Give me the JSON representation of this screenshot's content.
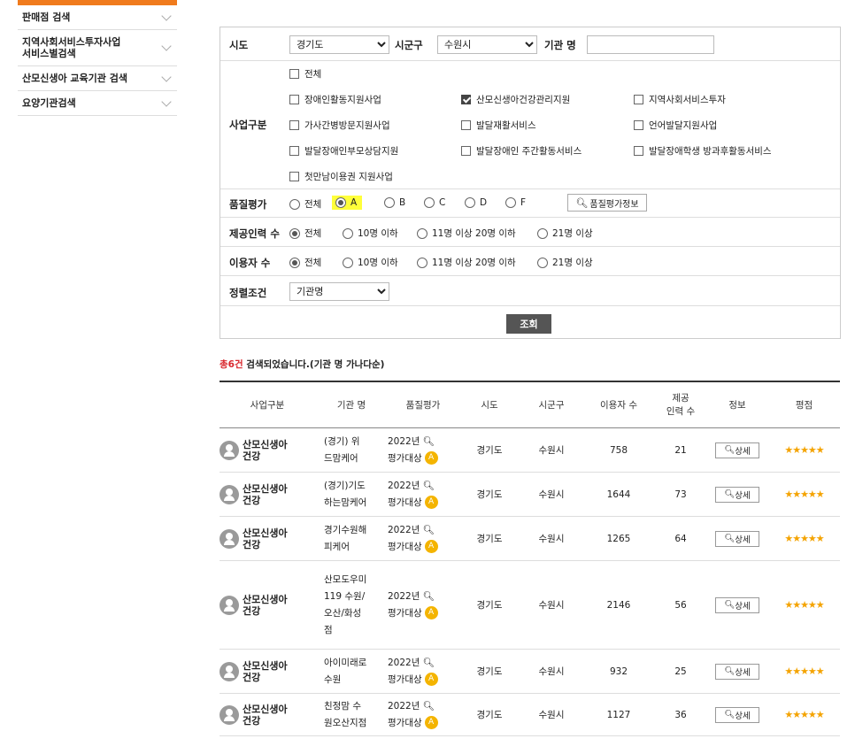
{
  "sidebar": {
    "items": [
      {
        "label": "판매점 검색"
      },
      {
        "label": "지역사회서비스투자사업\n서비스별검색"
      },
      {
        "label": "산모신생아 교육기관 검색"
      },
      {
        "label": "요양기관검색"
      }
    ]
  },
  "form": {
    "region_label": "시도",
    "region_value": "경기도",
    "district_label": "시군구",
    "district_value": "수원시",
    "org_name_label": "기관 명",
    "org_name_value": "",
    "biz_label": "사업구분",
    "biz_options": [
      {
        "label": "전체",
        "checked": false
      },
      {
        "label": "장애인활동지원사업",
        "checked": false
      },
      {
        "label": "산모신생아건강관리지원",
        "checked": true
      },
      {
        "label": "지역사회서비스투자",
        "checked": false
      },
      {
        "label": "가사간병방문지원사업",
        "checked": false
      },
      {
        "label": "발달재활서비스",
        "checked": false
      },
      {
        "label": "언어발달지원사업",
        "checked": false
      },
      {
        "label": "발달장애인부모상담지원",
        "checked": false
      },
      {
        "label": "발달장애인 주간활동서비스",
        "checked": false
      },
      {
        "label": "발달장애학생 방과후활동서비스",
        "checked": false
      },
      {
        "label": "첫만남이용권 지원사업",
        "checked": false
      }
    ],
    "quality_label": "품질평가",
    "quality_options": [
      {
        "label": "전체",
        "selected": false
      },
      {
        "label": "A",
        "selected": true
      },
      {
        "label": "B",
        "selected": false
      },
      {
        "label": "C",
        "selected": false
      },
      {
        "label": "D",
        "selected": false
      },
      {
        "label": "F",
        "selected": false
      }
    ],
    "quality_info_button": "품질평가정보",
    "staff_label": "제공인력 수",
    "staff_options": [
      {
        "label": "전체",
        "selected": true
      },
      {
        "label": "10명 이하",
        "selected": false
      },
      {
        "label": "11명 이상 20명 이하",
        "selected": false
      },
      {
        "label": "21명 이상",
        "selected": false
      }
    ],
    "users_label": "이용자 수",
    "users_options": [
      {
        "label": "전체",
        "selected": true
      },
      {
        "label": "10명 이하",
        "selected": false
      },
      {
        "label": "11명 이상 20명 이하",
        "selected": false
      },
      {
        "label": "21명 이상",
        "selected": false
      }
    ],
    "sort_label": "정렬조건",
    "sort_value": "기관명",
    "submit_label": "조회"
  },
  "summary": {
    "count": "총6건",
    "text": " 검색되었습니다.(기관 명 가나다순)"
  },
  "table": {
    "headers": [
      "사업구분",
      "기관 명",
      "품질평가",
      "시도",
      "시군구",
      "이용자 수",
      "제공\n인력 수",
      "정보",
      "평점"
    ],
    "rows": [
      {
        "biz": "산모신생아\n건강",
        "org": "(경기) 위\n드맘케어",
        "year": "2022년",
        "eval": "평가대상",
        "grade": "A",
        "region": "경기도",
        "district": "수원시",
        "users": "758",
        "staff": "21",
        "detail": "상세",
        "stars": "★★★★★"
      },
      {
        "biz": "산모신생아\n건강",
        "org": "(경기)기도\n하는맘케어",
        "year": "2022년",
        "eval": "평가대상",
        "grade": "A",
        "region": "경기도",
        "district": "수원시",
        "users": "1644",
        "staff": "73",
        "detail": "상세",
        "stars": "★★★★★"
      },
      {
        "biz": "산모신생아\n건강",
        "org": "경기수원해\n피케어",
        "year": "2022년",
        "eval": "평가대상",
        "grade": "A",
        "region": "경기도",
        "district": "수원시",
        "users": "1265",
        "staff": "64",
        "detail": "상세",
        "stars": "★★★★★"
      },
      {
        "biz": "산모신생아\n건강",
        "org": "산모도우미\n119 수원/\n오산/화성\n점",
        "year": "2022년",
        "eval": "평가대상",
        "grade": "A",
        "region": "경기도",
        "district": "수원시",
        "users": "2146",
        "staff": "56",
        "detail": "상세",
        "stars": "★★★★★"
      },
      {
        "biz": "산모신생아\n건강",
        "org": "아이미래로\n수원",
        "year": "2022년",
        "eval": "평가대상",
        "grade": "A",
        "region": "경기도",
        "district": "수원시",
        "users": "932",
        "staff": "25",
        "detail": "상세",
        "stars": "★★★★★"
      },
      {
        "biz": "산모신생아\n건강",
        "org": "친정맘 수\n원오산지점",
        "year": "2022년",
        "eval": "평가대상",
        "grade": "A",
        "region": "경기도",
        "district": "수원시",
        "users": "1127",
        "staff": "36",
        "detail": "상세",
        "stars": "★★★★★"
      }
    ]
  }
}
